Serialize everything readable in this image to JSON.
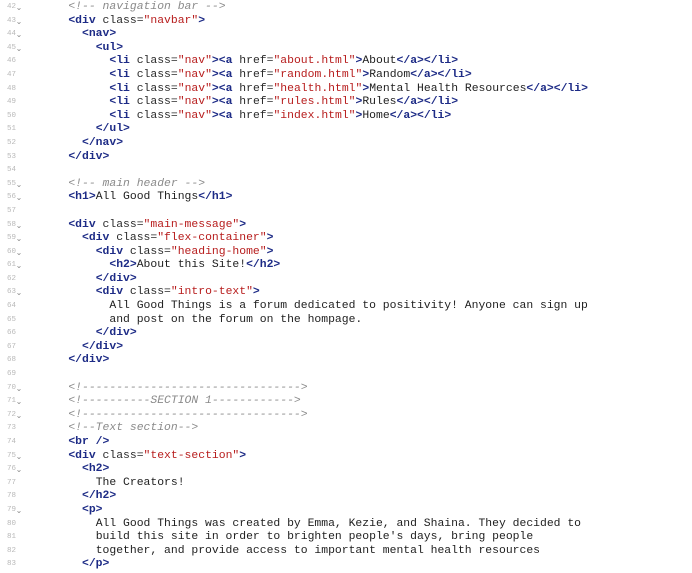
{
  "editor": {
    "first_line": 42,
    "fold_glyph": "⌄",
    "lines": [
      {
        "n": "42",
        "fold": true,
        "t": [
          [
            "    ",
            "p"
          ],
          [
            "<!-- navigation bar -->",
            "c"
          ]
        ]
      },
      {
        "n": "43",
        "fold": true,
        "t": [
          [
            "    ",
            "p"
          ],
          [
            "<div",
            "g"
          ],
          [
            " class",
            "a"
          ],
          [
            "=",
            "p"
          ],
          [
            "\"navbar\"",
            "s"
          ],
          [
            ">",
            "g"
          ]
        ]
      },
      {
        "n": "44",
        "fold": true,
        "t": [
          [
            "      ",
            "p"
          ],
          [
            "<nav>",
            "g"
          ]
        ]
      },
      {
        "n": "45",
        "fold": true,
        "t": [
          [
            "        ",
            "p"
          ],
          [
            "<ul>",
            "g"
          ]
        ]
      },
      {
        "n": "46",
        "fold": false,
        "t": [
          [
            "          ",
            "p"
          ],
          [
            "<li",
            "g"
          ],
          [
            " class",
            "a"
          ],
          [
            "=",
            "p"
          ],
          [
            "\"nav\"",
            "s"
          ],
          [
            "><a",
            "g"
          ],
          [
            " href",
            "a"
          ],
          [
            "=",
            "p"
          ],
          [
            "\"about.html\"",
            "s"
          ],
          [
            ">",
            "g"
          ],
          [
            "About",
            "x"
          ],
          [
            "</a></li>",
            "g"
          ]
        ]
      },
      {
        "n": "47",
        "fold": false,
        "t": [
          [
            "          ",
            "p"
          ],
          [
            "<li",
            "g"
          ],
          [
            " class",
            "a"
          ],
          [
            "=",
            "p"
          ],
          [
            "\"nav\"",
            "s"
          ],
          [
            "><a",
            "g"
          ],
          [
            " href",
            "a"
          ],
          [
            "=",
            "p"
          ],
          [
            "\"random.html\"",
            "s"
          ],
          [
            ">",
            "g"
          ],
          [
            "Random",
            "x"
          ],
          [
            "</a></li>",
            "g"
          ]
        ]
      },
      {
        "n": "48",
        "fold": false,
        "t": [
          [
            "          ",
            "p"
          ],
          [
            "<li",
            "g"
          ],
          [
            " class",
            "a"
          ],
          [
            "=",
            "p"
          ],
          [
            "\"nav\"",
            "s"
          ],
          [
            "><a",
            "g"
          ],
          [
            " href",
            "a"
          ],
          [
            "=",
            "p"
          ],
          [
            "\"health.html\"",
            "s"
          ],
          [
            ">",
            "g"
          ],
          [
            "Mental Health Resources",
            "x"
          ],
          [
            "</a></li>",
            "g"
          ]
        ]
      },
      {
        "n": "49",
        "fold": false,
        "t": [
          [
            "          ",
            "p"
          ],
          [
            "<li",
            "g"
          ],
          [
            " class",
            "a"
          ],
          [
            "=",
            "p"
          ],
          [
            "\"nav\"",
            "s"
          ],
          [
            "><a",
            "g"
          ],
          [
            " href",
            "a"
          ],
          [
            "=",
            "p"
          ],
          [
            "\"rules.html\"",
            "s"
          ],
          [
            ">",
            "g"
          ],
          [
            "Rules",
            "x"
          ],
          [
            "</a></li>",
            "g"
          ]
        ]
      },
      {
        "n": "50",
        "fold": false,
        "t": [
          [
            "          ",
            "p"
          ],
          [
            "<li",
            "g"
          ],
          [
            " class",
            "a"
          ],
          [
            "=",
            "p"
          ],
          [
            "\"nav\"",
            "s"
          ],
          [
            "><a",
            "g"
          ],
          [
            " href",
            "a"
          ],
          [
            "=",
            "p"
          ],
          [
            "\"index.html\"",
            "s"
          ],
          [
            ">",
            "g"
          ],
          [
            "Home",
            "x"
          ],
          [
            "</a></li>",
            "g"
          ]
        ]
      },
      {
        "n": "51",
        "fold": false,
        "t": [
          [
            "        ",
            "p"
          ],
          [
            "</ul>",
            "g"
          ]
        ]
      },
      {
        "n": "52",
        "fold": false,
        "t": [
          [
            "      ",
            "p"
          ],
          [
            "</nav>",
            "g"
          ]
        ]
      },
      {
        "n": "53",
        "fold": false,
        "t": [
          [
            "    ",
            "p"
          ],
          [
            "</div>",
            "g"
          ]
        ]
      },
      {
        "n": "54",
        "fold": false,
        "t": []
      },
      {
        "n": "55",
        "fold": true,
        "t": [
          [
            "    ",
            "p"
          ],
          [
            "<!-- main header -->",
            "c"
          ]
        ]
      },
      {
        "n": "56",
        "fold": true,
        "t": [
          [
            "    ",
            "p"
          ],
          [
            "<h1>",
            "g"
          ],
          [
            "All Good Things",
            "x"
          ],
          [
            "</h1>",
            "g"
          ]
        ]
      },
      {
        "n": "57",
        "fold": false,
        "t": []
      },
      {
        "n": "58",
        "fold": true,
        "t": [
          [
            "    ",
            "p"
          ],
          [
            "<div",
            "g"
          ],
          [
            " class",
            "a"
          ],
          [
            "=",
            "p"
          ],
          [
            "\"main-message\"",
            "s"
          ],
          [
            ">",
            "g"
          ]
        ]
      },
      {
        "n": "59",
        "fold": true,
        "t": [
          [
            "      ",
            "p"
          ],
          [
            "<div",
            "g"
          ],
          [
            " class",
            "a"
          ],
          [
            "=",
            "p"
          ],
          [
            "\"flex-container\"",
            "s"
          ],
          [
            ">",
            "g"
          ]
        ]
      },
      {
        "n": "60",
        "fold": true,
        "t": [
          [
            "        ",
            "p"
          ],
          [
            "<div",
            "g"
          ],
          [
            " class",
            "a"
          ],
          [
            "=",
            "p"
          ],
          [
            "\"heading-home\"",
            "s"
          ],
          [
            ">",
            "g"
          ]
        ]
      },
      {
        "n": "61",
        "fold": true,
        "t": [
          [
            "          ",
            "p"
          ],
          [
            "<h2>",
            "g"
          ],
          [
            "About this Site!",
            "x"
          ],
          [
            "</h2>",
            "g"
          ]
        ]
      },
      {
        "n": "62",
        "fold": false,
        "t": [
          [
            "        ",
            "p"
          ],
          [
            "</div>",
            "g"
          ]
        ]
      },
      {
        "n": "63",
        "fold": true,
        "t": [
          [
            "        ",
            "p"
          ],
          [
            "<div",
            "g"
          ],
          [
            " class",
            "a"
          ],
          [
            "=",
            "p"
          ],
          [
            "\"intro-text\"",
            "s"
          ],
          [
            ">",
            "g"
          ]
        ]
      },
      {
        "n": "64",
        "fold": false,
        "t": [
          [
            "          ",
            "p"
          ],
          [
            "All Good Things is a forum dedicated to positivity! Anyone can sign up",
            "x"
          ]
        ]
      },
      {
        "n": "65",
        "fold": false,
        "t": [
          [
            "          ",
            "p"
          ],
          [
            "and post on the forum on the hompage.",
            "x"
          ]
        ]
      },
      {
        "n": "66",
        "fold": false,
        "t": [
          [
            "        ",
            "p"
          ],
          [
            "</div>",
            "g"
          ]
        ]
      },
      {
        "n": "67",
        "fold": false,
        "t": [
          [
            "      ",
            "p"
          ],
          [
            "</div>",
            "g"
          ]
        ]
      },
      {
        "n": "68",
        "fold": false,
        "t": [
          [
            "    ",
            "p"
          ],
          [
            "</div>",
            "g"
          ]
        ]
      },
      {
        "n": "69",
        "fold": false,
        "t": []
      },
      {
        "n": "70",
        "fold": true,
        "t": [
          [
            "    ",
            "p"
          ],
          [
            "<!-------------------------------->",
            "c"
          ]
        ]
      },
      {
        "n": "71",
        "fold": true,
        "t": [
          [
            "    ",
            "p"
          ],
          [
            "<!----------SECTION 1------------>",
            "c"
          ]
        ]
      },
      {
        "n": "72",
        "fold": true,
        "t": [
          [
            "    ",
            "p"
          ],
          [
            "<!-------------------------------->",
            "c"
          ]
        ]
      },
      {
        "n": "73",
        "fold": false,
        "t": [
          [
            "    ",
            "p"
          ],
          [
            "<!--Text section-->",
            "c"
          ]
        ]
      },
      {
        "n": "74",
        "fold": false,
        "t": [
          [
            "    ",
            "p"
          ],
          [
            "<br />",
            "g"
          ]
        ]
      },
      {
        "n": "75",
        "fold": true,
        "t": [
          [
            "    ",
            "p"
          ],
          [
            "<div",
            "g"
          ],
          [
            " class",
            "a"
          ],
          [
            "=",
            "p"
          ],
          [
            "\"text-section\"",
            "s"
          ],
          [
            ">",
            "g"
          ]
        ]
      },
      {
        "n": "76",
        "fold": true,
        "t": [
          [
            "      ",
            "p"
          ],
          [
            "<h2>",
            "g"
          ]
        ]
      },
      {
        "n": "77",
        "fold": false,
        "t": [
          [
            "        ",
            "p"
          ],
          [
            "The Creators!",
            "x"
          ]
        ]
      },
      {
        "n": "78",
        "fold": false,
        "t": [
          [
            "      ",
            "p"
          ],
          [
            "</h2>",
            "g"
          ]
        ]
      },
      {
        "n": "79",
        "fold": true,
        "t": [
          [
            "      ",
            "p"
          ],
          [
            "<p>",
            "g"
          ]
        ]
      },
      {
        "n": "80",
        "fold": false,
        "t": [
          [
            "        ",
            "p"
          ],
          [
            "All Good Things was created by Emma, Kezie, and Shaina. They decided to",
            "x"
          ]
        ]
      },
      {
        "n": "81",
        "fold": false,
        "t": [
          [
            "        ",
            "p"
          ],
          [
            "build this site in order to brighten people's days, bring people",
            "x"
          ]
        ]
      },
      {
        "n": "82",
        "fold": false,
        "t": [
          [
            "        ",
            "p"
          ],
          [
            "together, and provide access to important mental health resources",
            "x"
          ]
        ]
      },
      {
        "n": "83",
        "fold": false,
        "t": [
          [
            "      ",
            "p"
          ],
          [
            "</p>",
            "g"
          ]
        ]
      }
    ]
  },
  "colors": {
    "tag": "#1d2b86",
    "string": "#b71c1c",
    "comment": "#8a8a8a",
    "text": "#1e1e1e",
    "line_number": "#b8b8b8",
    "background": "#ffffff"
  }
}
